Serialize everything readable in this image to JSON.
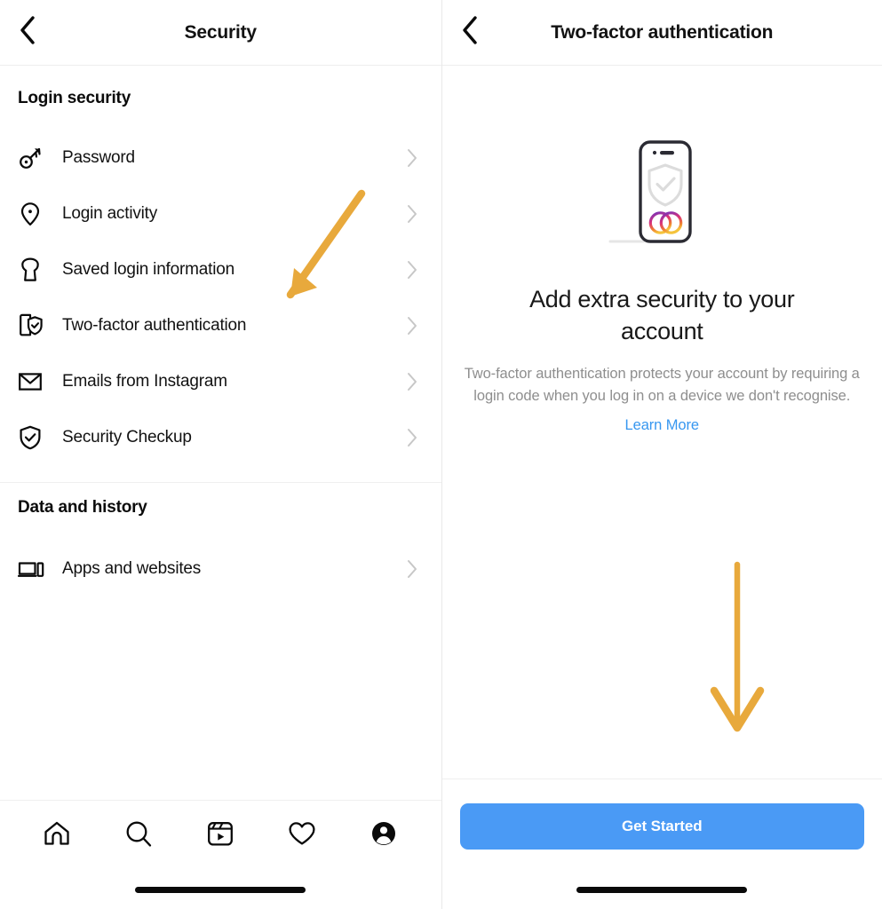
{
  "left_screen": {
    "header": {
      "back_icon": "chevron-left-icon",
      "title": "Security"
    },
    "sections": [
      {
        "title": "Login security",
        "items": [
          {
            "label": "Password",
            "icon": "key-icon",
            "chevron": "chevron-right-icon"
          },
          {
            "label": "Login activity",
            "icon": "location-pin-icon",
            "chevron": "chevron-right-icon"
          },
          {
            "label": "Saved login information",
            "icon": "keyhole-lock-icon",
            "chevron": "chevron-right-icon"
          },
          {
            "label": "Two-factor authentication",
            "icon": "phone-shield-check-icon",
            "chevron": "chevron-right-icon"
          },
          {
            "label": "Emails from Instagram",
            "icon": "envelope-icon",
            "chevron": "chevron-right-icon"
          },
          {
            "label": "Security Checkup",
            "icon": "shield-check-icon",
            "chevron": "chevron-right-icon"
          }
        ]
      },
      {
        "title": "Data and history",
        "items": [
          {
            "label": "Apps and websites",
            "icon": "devices-icon",
            "chevron": "chevron-right-icon"
          }
        ]
      }
    ],
    "tabbar": [
      {
        "name": "home-icon"
      },
      {
        "name": "search-icon"
      },
      {
        "name": "reels-icon"
      },
      {
        "name": "heart-icon"
      },
      {
        "name": "profile-icon"
      }
    ]
  },
  "right_screen": {
    "header": {
      "back_icon": "chevron-left-icon",
      "title": "Two-factor authentication"
    },
    "illustration": {
      "name": "phone-with-shield-illustration",
      "shield_icon": "shield-check-icon",
      "rings_icon": "two-rings-icon"
    },
    "title": "Add extra security to your account",
    "body": "Two-factor authentication protects your account by requiring a login code when you log in on a device we don't recognise.",
    "learn_more": "Learn More",
    "cta_label": "Get Started"
  },
  "annotations": [
    {
      "name": "arrow-to-two-factor-authentication",
      "direction": "down-left"
    },
    {
      "name": "arrow-to-get-started",
      "direction": "down"
    }
  ],
  "colors": {
    "accent_blue": "#4a9af5",
    "link_blue": "#3797f0",
    "annotation_orange": "#e8a93c",
    "muted_text": "#8e8e8e",
    "primary_text": "#121212",
    "divider": "#efefef"
  }
}
